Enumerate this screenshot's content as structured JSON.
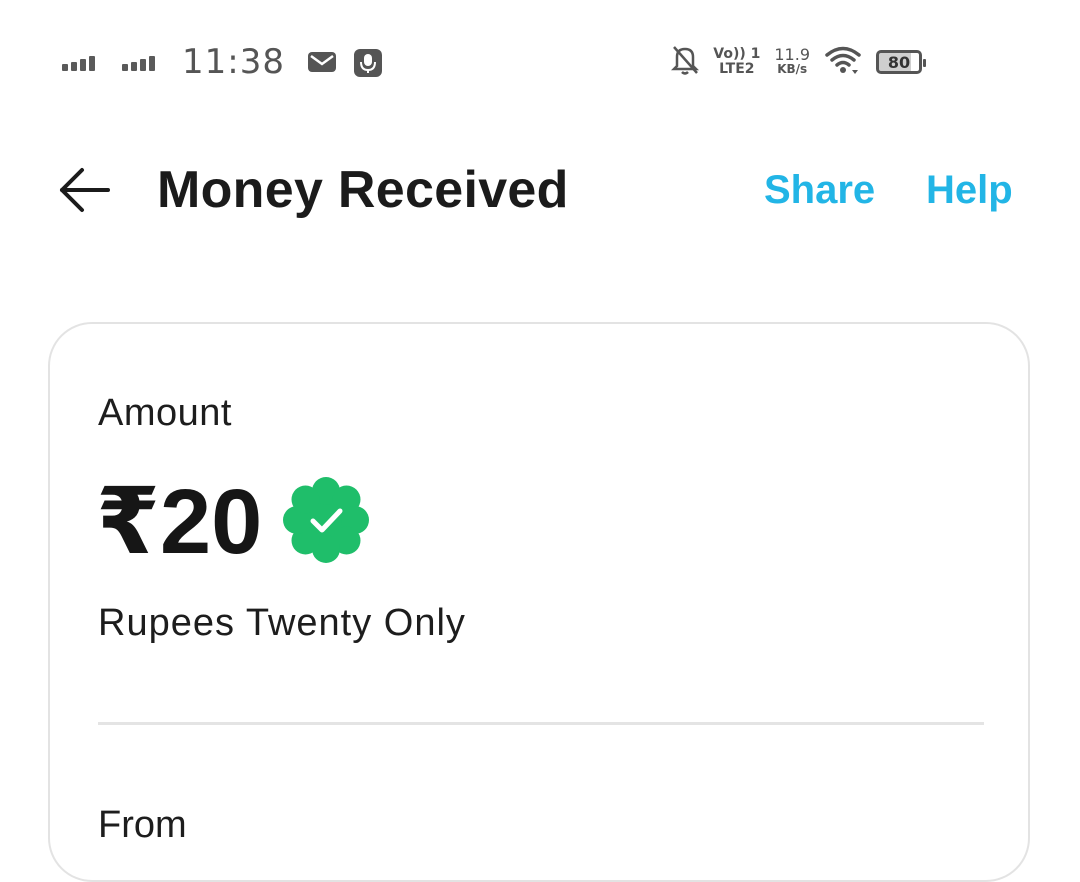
{
  "status_bar": {
    "time": "11:38",
    "volte": "Vo",
    "volte_sub": "1",
    "lte": "LTE2",
    "speed_value": "11.9",
    "speed_unit": "KB/s",
    "battery": "80",
    "icons": [
      "signal-1-icon",
      "signal-2-icon",
      "mail-icon",
      "mic-icon",
      "bell-off-icon",
      "wifi-icon",
      "battery-icon"
    ]
  },
  "header": {
    "title": "Money Received",
    "share_label": "Share",
    "help_label": "Help",
    "link_color": "#22b5e6"
  },
  "details": {
    "amount_label": "Amount",
    "amount_value": "₹20",
    "amount_words": "Rupees Twenty Only",
    "verified_color": "#1fbe6a",
    "from_label": "From"
  }
}
